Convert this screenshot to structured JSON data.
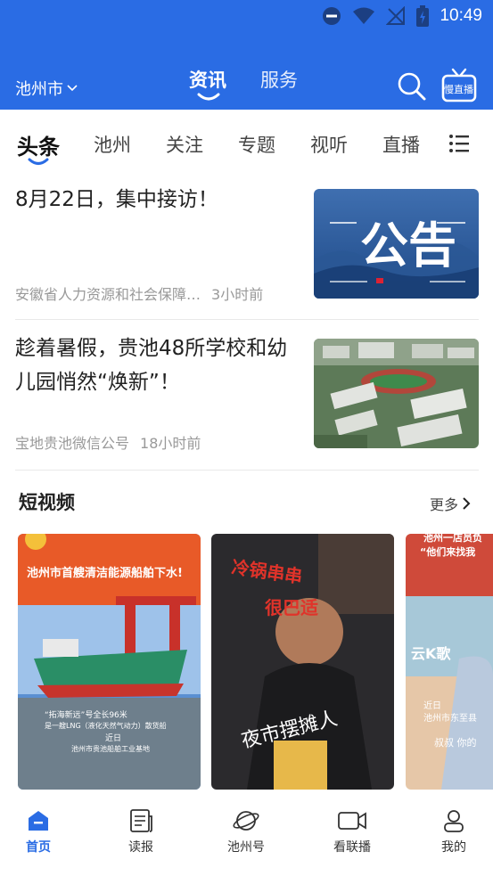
{
  "status": {
    "time": "10:49"
  },
  "header": {
    "city": "池州市",
    "tabs": [
      {
        "label": "资讯",
        "active": true
      },
      {
        "label": "服务",
        "active": false
      }
    ],
    "live_label": "慢直播"
  },
  "channels": [
    "头条",
    "池州",
    "关注",
    "专题",
    "视听",
    "直播"
  ],
  "news": [
    {
      "title": "8月22日，集中接访！",
      "source": "安徽省人力资源和社会保障…",
      "time": "3小时前",
      "thumb_text": "公告"
    },
    {
      "title": "趁着暑假，贵池48所学校和幼儿园悄然“焕新”！",
      "source": "宝地贵池微信公号",
      "time": "18小时前"
    }
  ],
  "short_video": {
    "title": "短视频",
    "more": "更多",
    "cards": [
      {
        "headline": "池州市首艘清洁能源船舶下水!",
        "caption1": "“拓海新远”号全长96米",
        "caption2": "是一艘LNG（液化天然气动力）散货船",
        "caption3": "近日",
        "caption4": "池州市贵池船舶工业基地"
      },
      {
        "text1": "冷锅串串",
        "text2": "很巴适",
        "text3": "夜市摆摊人"
      },
      {
        "headline": "池州一店员负",
        "subhead": "“他们来找我",
        "sign": "云K歌",
        "caption1": "近日",
        "caption2": "池州市东至县",
        "caption3": "叔叔 你的"
      }
    ]
  },
  "tabbar": [
    {
      "label": "首页",
      "icon": "home-icon",
      "active": true
    },
    {
      "label": "读报",
      "icon": "newspaper-icon",
      "active": false
    },
    {
      "label": "池州号",
      "icon": "planet-icon",
      "active": false
    },
    {
      "label": "看联播",
      "icon": "video-camera-icon",
      "active": false
    },
    {
      "label": "我的",
      "icon": "user-icon",
      "active": false
    }
  ],
  "colors": {
    "brand": "#2a6ce4",
    "active_tab": "#2a6ce4"
  }
}
